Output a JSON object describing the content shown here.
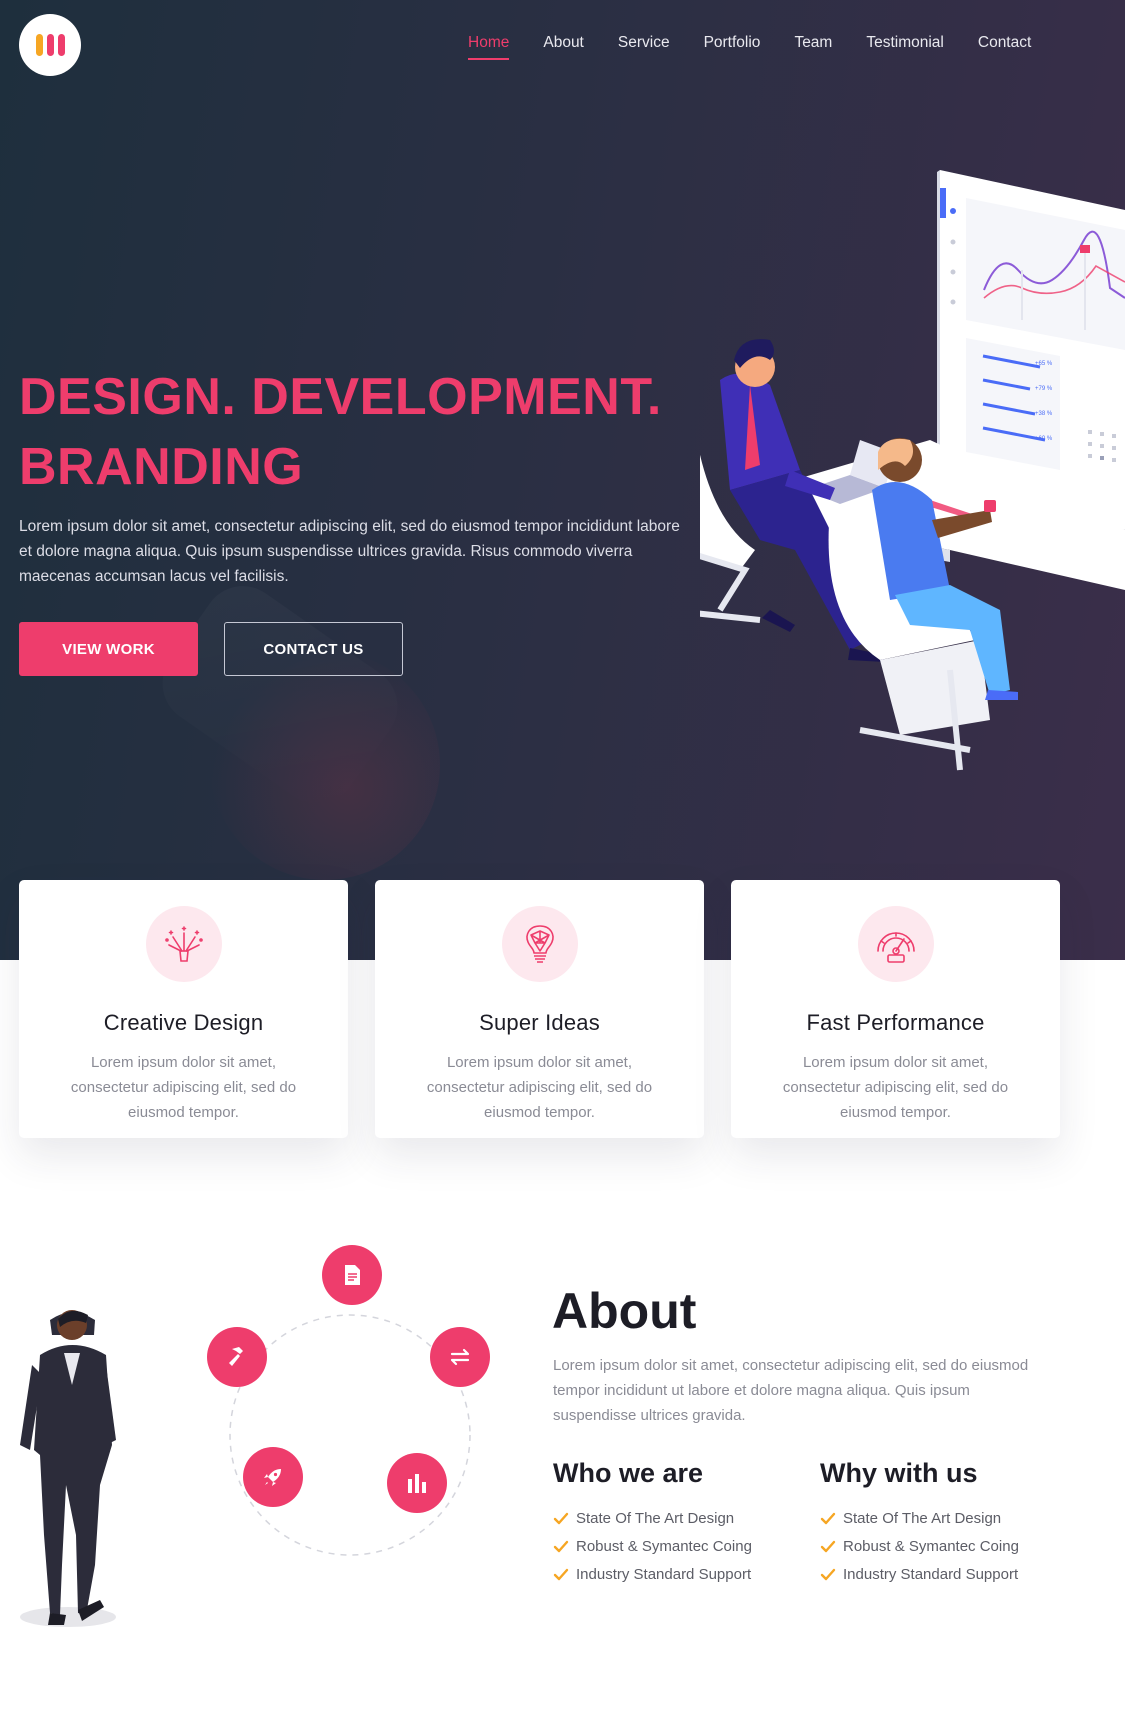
{
  "brand": {
    "logo_colors": [
      "#f6a623",
      "#ee3d6c",
      "#ee3d6c"
    ]
  },
  "nav": {
    "items": [
      {
        "label": "Home",
        "active": true
      },
      {
        "label": "About"
      },
      {
        "label": "Service"
      },
      {
        "label": "Portfolio"
      },
      {
        "label": "Team"
      },
      {
        "label": "Testimonial"
      },
      {
        "label": "Contact"
      }
    ]
  },
  "hero": {
    "headline_line1": "DESIGN. DEVELOPMENT.",
    "headline_line2": "BRANDING",
    "text": "Lorem ipsum dolor sit amet, consectetur adipiscing elit, sed do eiusmod tempor incididunt labore et dolore magna aliqua. Quis ipsum suspendisse ultrices gravida. Risus commodo viverra maecenas accumsan lacus vel facilisis.",
    "primary_button": "VIEW WORK",
    "secondary_button": "CONTACT US",
    "illustration_labels": [
      "+65 %",
      "+79 %",
      "+38 %",
      "+60 %"
    ]
  },
  "features": [
    {
      "icon": "fireworks-icon",
      "title": "Creative Design",
      "text": "Lorem ipsum dolor sit amet, consectetur adipiscing elit, sed do eiusmod tempor."
    },
    {
      "icon": "lightbulb-brain-icon",
      "title": "Super Ideas",
      "text": "Lorem ipsum dolor sit amet, consectetur adipiscing elit, sed do eiusmod tempor."
    },
    {
      "icon": "speedometer-icon",
      "title": "Fast Performance",
      "text": "Lorem ipsum dolor sit amet, consectetur adipiscing elit, sed do eiusmod tempor."
    }
  ],
  "about": {
    "title": "About",
    "text": "Lorem ipsum dolor sit amet, consectetur adipiscing elit, sed do eiusmod tempor incididunt ut labore et dolore magna aliqua. Quis ipsum suspendisse ultrices gravida.",
    "orbit_icons": [
      "document-icon",
      "swap-icon",
      "bar-chart-icon",
      "rocket-icon",
      "hammer-icon"
    ],
    "who_we_are": {
      "title": "Who we are",
      "items": [
        "State Of The Art Design",
        "Robust & Symantec Coing",
        "Industry Standard Support"
      ]
    },
    "why_with_us": {
      "title": "Why with us",
      "items": [
        "State Of The Art Design",
        "Robust & Symantec Coing",
        "Industry Standard Support"
      ]
    }
  },
  "colors": {
    "accent": "#ee3d6c",
    "check": "#f6a623",
    "hero_bg": "#2a2f43"
  }
}
